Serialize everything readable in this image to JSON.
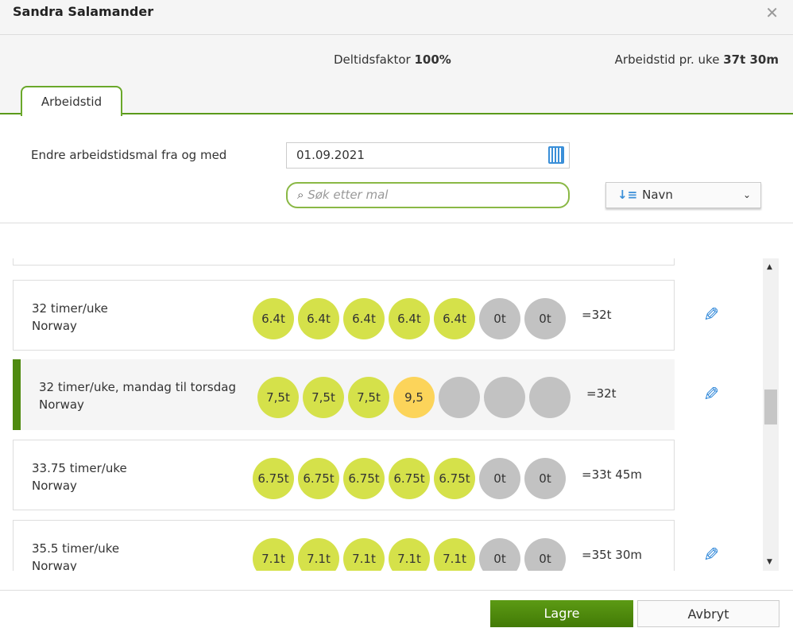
{
  "dialog": {
    "title": "Sandra Salamander"
  },
  "info": {
    "factor_label": "Deltidsfaktor",
    "factor_value": "100%",
    "hours_label": "Arbeidstid pr. uke",
    "hours_value": "37t 30m"
  },
  "tabs": [
    {
      "label": "Arbeidstid",
      "active": true
    }
  ],
  "form": {
    "date_label": "Endre arbeidstidsmal fra og med",
    "date_value": "01.09.2021",
    "search_placeholder": "Søk etter mal",
    "sort_value": "Navn"
  },
  "templates": [
    {
      "name": "32 timer/uke",
      "country": "Norway",
      "days": [
        "6.4t",
        "6.4t",
        "6.4t",
        "6.4t",
        "6.4t",
        "0t",
        "0t"
      ],
      "total": "=32t",
      "editable": true
    },
    {
      "name": "32 timer/uke, mandag til torsdag",
      "country": "Norway",
      "days": [
        "7,5t",
        "7,5t",
        "7,5t",
        "9,5",
        "",
        "",
        ""
      ],
      "total": "=32t",
      "editable": true,
      "selected": true
    },
    {
      "name": "33.75 timer/uke",
      "country": "Norway",
      "days": [
        "6.75t",
        "6.75t",
        "6.75t",
        "6.75t",
        "6.75t",
        "0t",
        "0t"
      ],
      "total": "=33t 45m",
      "editable": false
    },
    {
      "name": "35.5 timer/uke",
      "country": "Norway",
      "days": [
        "7.1t",
        "7.1t",
        "7.1t",
        "7.1t",
        "7.1t",
        "0t",
        "0t"
      ],
      "total": "=35t 30m",
      "editable": true
    }
  ],
  "colors": {
    "accent": "#5a9a1a",
    "work_day": "#d5e14a",
    "off_day": "#c2c2c2",
    "overtime": "#fcd45a",
    "edit": "#2b85d8"
  },
  "footer": {
    "save": "Lagre",
    "cancel": "Avbryt"
  }
}
